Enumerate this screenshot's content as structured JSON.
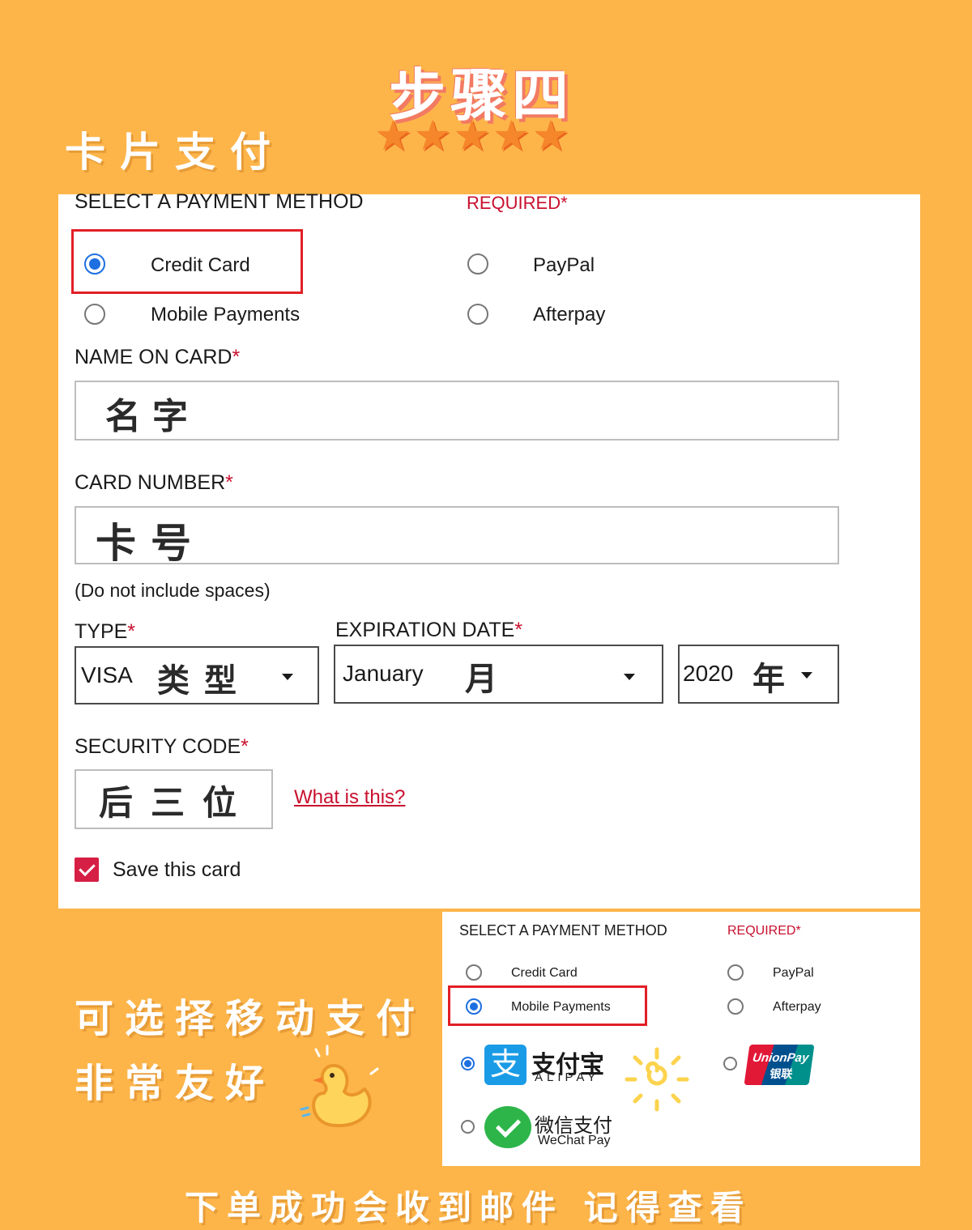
{
  "header": {
    "step_title": "步骤四",
    "stars": "★★★★★",
    "section_heading": "卡片支付"
  },
  "form": {
    "select_method_label": "SELECT A PAYMENT METHOD",
    "required_label": "REQUIRED",
    "required_mark": "*",
    "options": {
      "credit_card": "Credit Card",
      "paypal": "PayPal",
      "mobile_payments": "Mobile Payments",
      "afterpay": "Afterpay"
    },
    "selected_option": "Credit Card",
    "name_label": "NAME ON CARD",
    "name_value": "名字",
    "card_number_label": "CARD NUMBER",
    "card_number_value": "卡号",
    "card_number_hint": "(Do not include spaces)",
    "type_label": "TYPE",
    "type_value": "VISA",
    "type_note": "类型",
    "expiration_label": "EXPIRATION DATE",
    "month_value": "January",
    "month_note": "月",
    "year_value": "2020",
    "year_note": "年",
    "security_label": "SECURITY CODE",
    "security_value": "后三位",
    "what_is_this": "What is this?",
    "save_card_label": "Save this card",
    "save_card_checked": true
  },
  "mobile_panel": {
    "select_method_label": "SELECT A PAYMENT METHOD",
    "required_label": "REQUIRED",
    "required_mark": "*",
    "options": {
      "credit_card": "Credit Card",
      "paypal": "PayPal",
      "mobile_payments": "Mobile Payments",
      "afterpay": "Afterpay"
    },
    "selected_option": "Mobile Payments",
    "alipay": {
      "logo_glyph": "支",
      "name": "支付宝",
      "sub": "ALIPAY",
      "selected": true
    },
    "wechat": {
      "name": "微信支付",
      "sub": "WeChat Pay",
      "selected": false
    },
    "unionpay": {
      "name": "UnionPay",
      "cn": "银联",
      "selected": false
    }
  },
  "promo": {
    "line1": "可选择移动支付",
    "line2": "非常友好",
    "footer": "下单成功会收到邮件 记得查看"
  },
  "colors": {
    "background": "#FDB54A",
    "accent_red": "#C8102E",
    "highlight_red": "#E21F26",
    "radio_blue": "#1E6FE0",
    "checkbox_red": "#D61F44"
  }
}
